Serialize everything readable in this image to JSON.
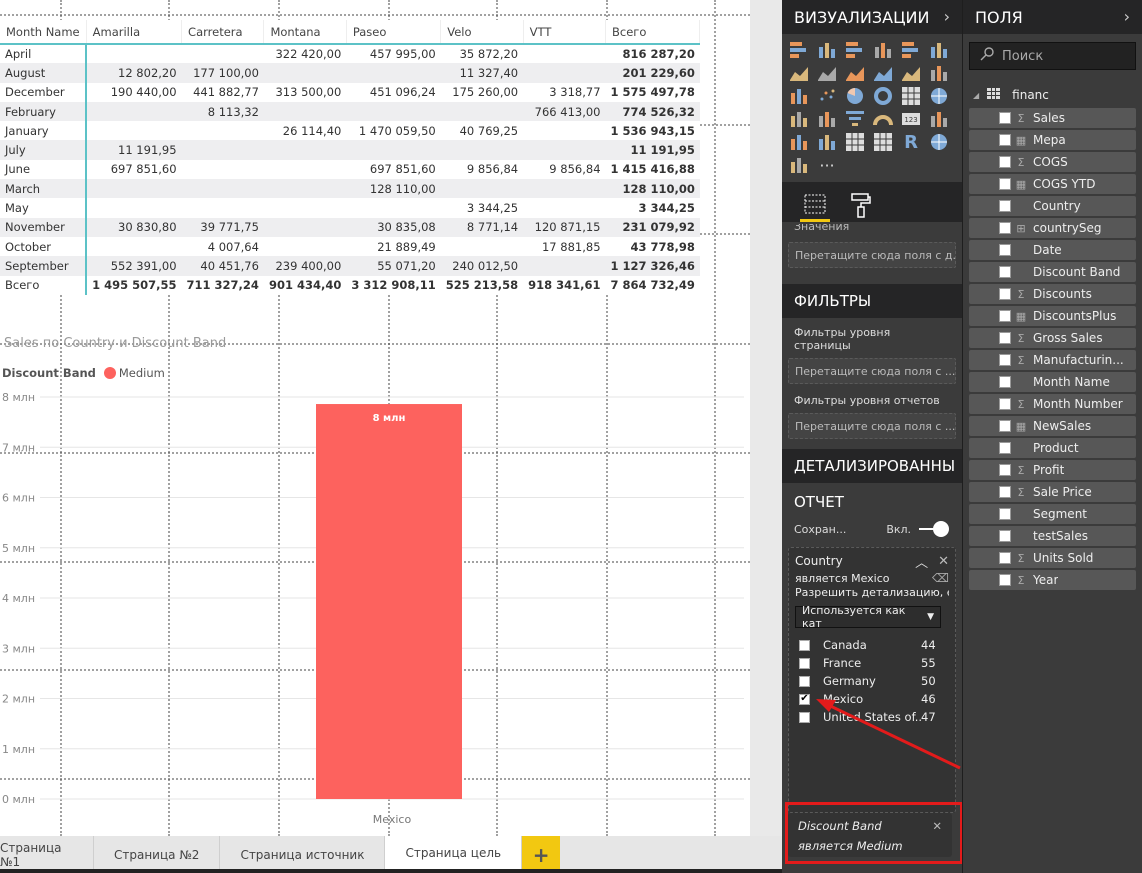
{
  "matrix": {
    "headers": [
      "Month Name",
      "Amarilla",
      "Carretera",
      "Montana",
      "Paseo",
      "Velo",
      "VTT",
      "Всего"
    ],
    "rows": [
      [
        "April",
        "",
        "",
        "322 420,00",
        "457 995,00",
        "35 872,20",
        "",
        "816 287,20"
      ],
      [
        "August",
        "12 802,20",
        "177 100,00",
        "",
        "",
        "11 327,40",
        "",
        "201 229,60"
      ],
      [
        "December",
        "190 440,00",
        "441 882,77",
        "313 500,00",
        "451 096,24",
        "175 260,00",
        "3 318,77",
        "1 575 497,78"
      ],
      [
        "February",
        "",
        "8 113,32",
        "",
        "",
        "",
        "766 413,00",
        "774 526,32"
      ],
      [
        "January",
        "",
        "",
        "26 114,40",
        "1 470 059,50",
        "40 769,25",
        "",
        "1 536 943,15"
      ],
      [
        "July",
        "11 191,95",
        "",
        "",
        "",
        "",
        "",
        "11 191,95"
      ],
      [
        "June",
        "697 851,60",
        "",
        "",
        "697 851,60",
        "9 856,84",
        "9 856,84",
        "1 415 416,88"
      ],
      [
        "March",
        "",
        "",
        "",
        "128 110,00",
        "",
        "",
        "128 110,00"
      ],
      [
        "May",
        "",
        "",
        "",
        "",
        "3 344,25",
        "",
        "3 344,25"
      ],
      [
        "November",
        "30 830,80",
        "39 771,75",
        "",
        "30 835,08",
        "8 771,14",
        "120 871,15",
        "231 079,92"
      ],
      [
        "October",
        "",
        "4 007,64",
        "",
        "21 889,49",
        "",
        "17 881,85",
        "43 778,98"
      ],
      [
        "September",
        "552 391,00",
        "40 451,76",
        "239 400,00",
        "55 071,20",
        "240 012,50",
        "",
        "1 127 326,46"
      ]
    ],
    "total_row": [
      "Всего",
      "1 495 507,55",
      "711 327,24",
      "901 434,40",
      "3 312 908,11",
      "525 213,58",
      "918 341,61",
      "7 864 732,49"
    ]
  },
  "chart_data": {
    "type": "bar",
    "title": "Sales по Country и Discount Band",
    "legend_title": "Discount Band",
    "legend_position": "top-left",
    "categories": [
      "Mexico"
    ],
    "series": [
      {
        "name": "Medium",
        "color": "#fd625e",
        "values": [
          7.86
        ],
        "data_labels": [
          "8 млн"
        ]
      }
    ],
    "xlabel": "",
    "ylabel": "",
    "ylim": [
      0,
      8
    ],
    "yticks": [
      0,
      1,
      2,
      3,
      4,
      5,
      6,
      7,
      8
    ],
    "ytick_labels": [
      "0 млн",
      "1 млн",
      "2 млн",
      "3 млн",
      "4 млн",
      "5 млн",
      "6 млн",
      "7 млн",
      "8 млн"
    ],
    "grid": true
  },
  "page_tabs": [
    {
      "label": "Страница №1",
      "active": false
    },
    {
      "label": "Страница №2",
      "active": false
    },
    {
      "label": "Страница источник",
      "active": false
    },
    {
      "label": "Страница цель",
      "active": true
    }
  ],
  "add_page_label": "+",
  "visualizations": {
    "title": "ВИЗУАЛИЗАЦИИ",
    "chevron": "›",
    "icons": [
      "stacked-bar-icon",
      "stacked-column-icon",
      "clustered-bar-icon",
      "clustered-column-icon",
      "100-stacked-bar-icon",
      "100-stacked-column-icon",
      "line-chart-icon",
      "area-chart-icon",
      "stacked-area-icon",
      "line-clustered-column-icon",
      "line-stacked-column-icon",
      "ribbon-chart-icon",
      "waterfall-icon",
      "scatter-icon",
      "pie-chart-icon",
      "donut-chart-icon",
      "treemap-icon",
      "map-icon",
      "filled-map-icon",
      "shape-map-icon",
      "funnel-icon",
      "gauge-icon",
      "card-icon",
      "multi-row-card-icon",
      "kpi-icon",
      "slicer-icon",
      "table-icon",
      "matrix-icon",
      "r-script-icon",
      "arcgis-icon",
      "custom-visual-icon",
      "more-icon"
    ],
    "values_label": "Значения",
    "values_dropzone": "Перетащите сюда поля с д...",
    "filters_header": "ФИЛЬТРЫ",
    "page_filters_label": "Фильтры уровня страницы",
    "page_filters_dropzone": "Перетащите сюда поля с ...",
    "report_filters_label": "Фильтры уровня отчетов",
    "report_filters_dropzone": "Перетащите сюда поля с ...",
    "drillthrough_header": "ДЕТАЛИЗИРОВАННЫ",
    "report_label": "ОТЧЕТ",
    "keep_filters_label": "Сохран...",
    "keep_filters_toggle_label": "Вкл.",
    "keep_filters_on": true,
    "country_card": {
      "field": "Country",
      "condition": "является Mexico",
      "allow_text": "Разрешить детализацию, ес...",
      "filter_type": "Используется как кат",
      "items": [
        {
          "name": "Canada",
          "count": "44",
          "checked": false
        },
        {
          "name": "France",
          "count": "55",
          "checked": false
        },
        {
          "name": "Germany",
          "count": "50",
          "checked": false
        },
        {
          "name": "Mexico",
          "count": "46",
          "checked": true
        },
        {
          "name": "United States of...",
          "count": "47",
          "checked": false
        }
      ]
    },
    "discount_card": {
      "field": "Discount Band",
      "condition": "является Medium"
    }
  },
  "fields": {
    "title": "ПОЛЯ",
    "chevron": "›",
    "search_placeholder": "Поиск",
    "table_name": "financ",
    "items": [
      {
        "name": "Sales",
        "type": "Σ"
      },
      {
        "name": "Мера",
        "type": "▦"
      },
      {
        "name": "COGS",
        "type": "Σ"
      },
      {
        "name": "COGS YTD",
        "type": "▦"
      },
      {
        "name": "Country",
        "type": ""
      },
      {
        "name": "countrySeg",
        "type": "⊞"
      },
      {
        "name": "Date",
        "type": ""
      },
      {
        "name": "Discount Band",
        "type": ""
      },
      {
        "name": "Discounts",
        "type": "Σ"
      },
      {
        "name": "DiscountsPlus",
        "type": "▦"
      },
      {
        "name": "Gross Sales",
        "type": "Σ"
      },
      {
        "name": "Manufacturin...",
        "type": "Σ"
      },
      {
        "name": "Month Name",
        "type": ""
      },
      {
        "name": "Month Number",
        "type": "Σ"
      },
      {
        "name": "NewSales",
        "type": "▦"
      },
      {
        "name": "Product",
        "type": ""
      },
      {
        "name": "Profit",
        "type": "Σ"
      },
      {
        "name": "Sale Price",
        "type": "Σ"
      },
      {
        "name": "Segment",
        "type": ""
      },
      {
        "name": "testSales",
        "type": ""
      },
      {
        "name": "Units Sold",
        "type": "Σ"
      },
      {
        "name": "Year",
        "type": "Σ"
      }
    ]
  },
  "colors": {
    "accent_yellow": "#f2c811",
    "matrix_accent": "#5cc2c7",
    "bar": "#fd625e",
    "annotation_red": "#e31b1b"
  }
}
